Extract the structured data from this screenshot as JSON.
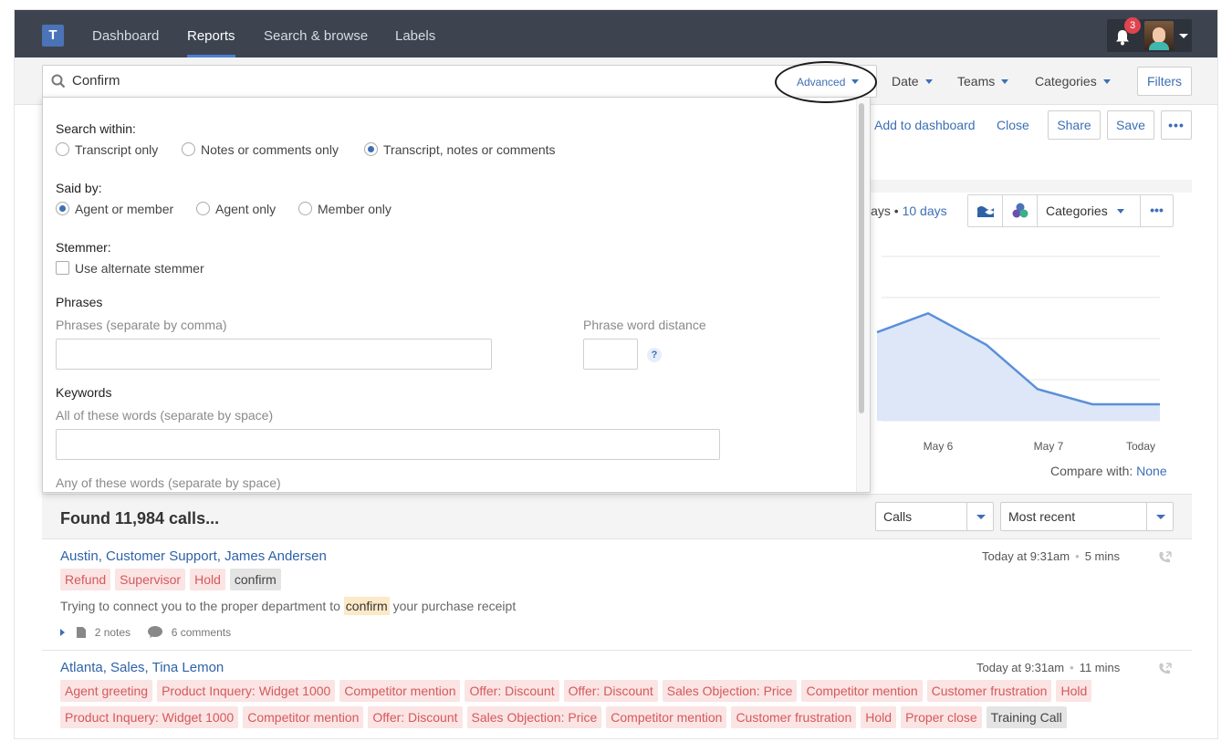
{
  "nav": {
    "logo": "T",
    "items": [
      "Dashboard",
      "Reports",
      "Search & browse",
      "Labels"
    ],
    "notification_count": "3"
  },
  "search": {
    "query": "Confirm",
    "advanced_label": "Advanced",
    "date_label": "Date",
    "teams_label": "Teams",
    "categories_label": "Categories",
    "filters_label": "Filters"
  },
  "report_header": {
    "add_to_dashboard": "Add to dashboard",
    "close": "Close",
    "share": "Share",
    "save": "Save",
    "more": "•••"
  },
  "chart": {
    "days_prefix": "lays",
    "days_sep": " • ",
    "days_selected": "10 days",
    "categories_label": "Categories",
    "more": "•••",
    "compare_label": "Compare with:",
    "compare_value": "None",
    "x_labels": [
      "May 6",
      "May 7",
      "Today"
    ],
    "line_color": "#5b8fd9",
    "fill_color": "#dde7f7"
  },
  "chart_data": {
    "type": "area",
    "x": [
      "",
      "May 6",
      "",
      "May 7",
      "",
      "Today"
    ],
    "values": [
      70,
      85,
      60,
      25,
      13,
      13
    ],
    "xlabel": "",
    "ylabel": "",
    "ylim": [
      0,
      130
    ],
    "grid": true
  },
  "advanced": {
    "search_within_label": "Search within:",
    "search_within_options": [
      "Transcript only",
      "Notes or comments only",
      "Transcript, notes or comments"
    ],
    "said_by_label": "Said by:",
    "said_by_options": [
      "Agent or member",
      "Agent only",
      "Member only"
    ],
    "stemmer_label": "Stemmer:",
    "stemmer_option": "Use alternate stemmer",
    "phrases_label": "Phrases",
    "phrases_hint": "Phrases (separate by comma)",
    "phrase_distance_hint": "Phrase word distance",
    "help": "?",
    "keywords_label": "Keywords",
    "all_words_hint": "All of these words (separate by space)",
    "any_words_hint": "Any of these words (separate by space)"
  },
  "results": {
    "found": "Found 11,984 calls...",
    "type_select": "Calls",
    "sort_select": "Most recent",
    "items": [
      {
        "title": "Austin, Customer Support, James Andersen",
        "time": "Today at 9:31am",
        "duration": "5 mins",
        "tags": [
          "Refund",
          "Supervisor",
          "Hold"
        ],
        "gray_tags": [
          "confirm"
        ],
        "snippet_before": "Trying to connect you to the proper department to ",
        "snippet_highlight": "confirm",
        "snippet_after": " your purchase receipt",
        "notes": "2 notes",
        "comments": "6 comments"
      },
      {
        "title": "Atlanta, Sales, Tina Lemon",
        "time": "Today at 9:31am",
        "duration": "11 mins",
        "tags": [
          "Agent greeting",
          "Product Inquery: Widget 1000",
          "Competitor mention",
          "Offer: Discount",
          "Offer: Discount",
          "Sales Objection: Price",
          "Competitor mention",
          "Customer frustration",
          "Hold",
          "Product Inquery: Widget 1000",
          "Competitor mention",
          "Offer: Discount",
          "Sales Objection: Price",
          "Competitor mention",
          "Customer frustration",
          "Hold",
          "Proper close"
        ],
        "gray_tags": [
          "Training Call"
        ]
      }
    ]
  }
}
